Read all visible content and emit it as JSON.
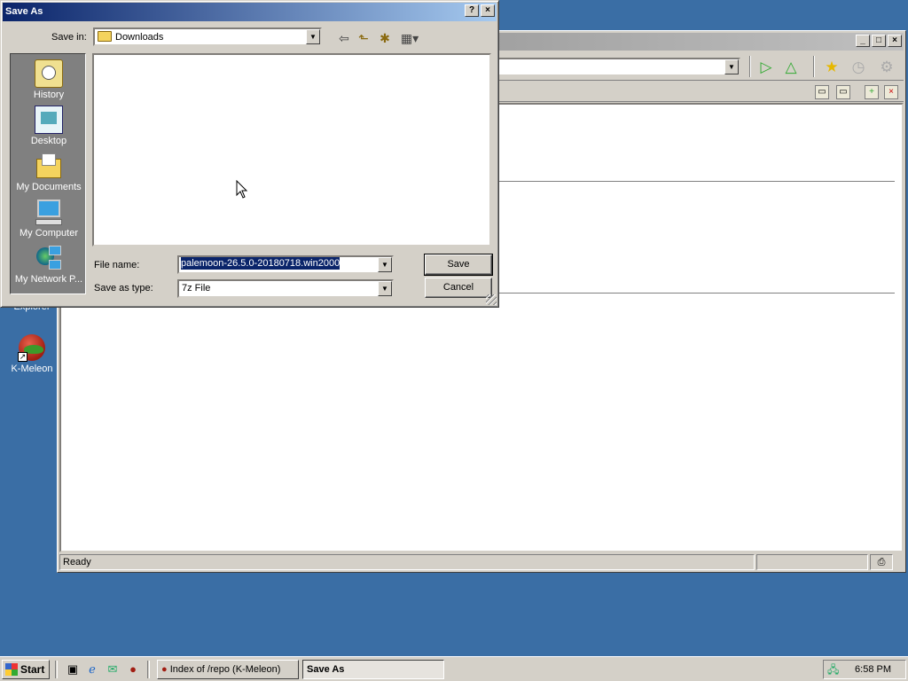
{
  "desktop": {
    "ie_label": "Explorer",
    "kmeleon_label": "K-Meleon"
  },
  "browser": {
    "status": "Ready"
  },
  "dialog": {
    "title": "Save As",
    "help_btn": "?",
    "close_btn": "×",
    "save_in_label": "Save in:",
    "save_in_value": "Downloads",
    "places": [
      {
        "label": "History",
        "icon": "history-icon"
      },
      {
        "label": "Desktop",
        "icon": "desktop-icon"
      },
      {
        "label": "My Documents",
        "icon": "my-documents-icon"
      },
      {
        "label": "My Computer",
        "icon": "my-computer-icon"
      },
      {
        "label": "My Network P...",
        "icon": "network-places-icon"
      }
    ],
    "file_name_label": "File name:",
    "file_name_value": "palemoon-26.5.0-20180718.win2000",
    "save_type_label": "Save as type:",
    "save_type_value": "7z File",
    "save_button": "Save",
    "cancel_button": "Cancel"
  },
  "taskbar": {
    "start": "Start",
    "tasks": [
      {
        "label": "Index of /repo (K-Meleon)",
        "active": false
      },
      {
        "label": "Save As",
        "active": true
      }
    ],
    "clock": "6:58 PM"
  }
}
